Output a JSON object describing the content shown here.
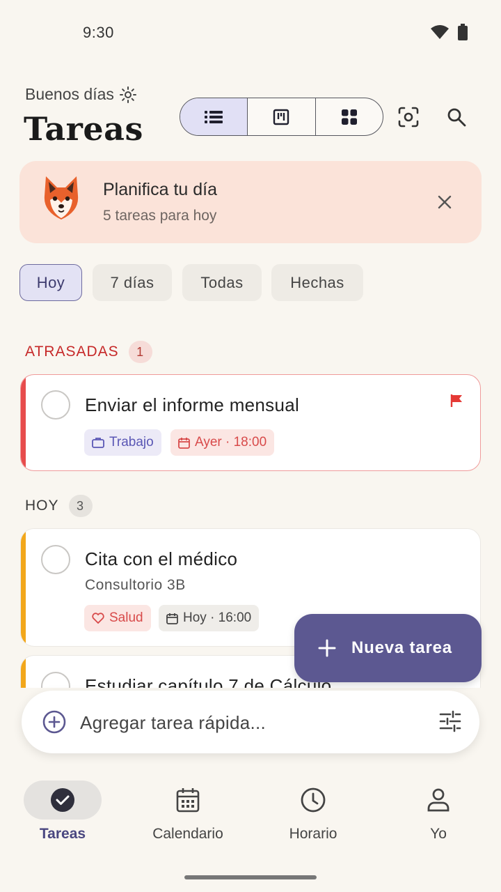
{
  "status_bar": {
    "time": "9:30"
  },
  "header": {
    "greeting": "Buenos días",
    "title": "Tareas"
  },
  "banner": {
    "title": "Planifica tu día",
    "subtitle": "5 tareas para hoy"
  },
  "filters": [
    "Hoy",
    "7 días",
    "Todas",
    "Hechas"
  ],
  "sections": {
    "overdue": {
      "label": "ATRASADAS",
      "count": "1"
    },
    "today": {
      "label": "HOY",
      "count": "3"
    }
  },
  "tasks": [
    {
      "title": "Enviar el informe mensual",
      "category": "Trabajo",
      "due": "Ayer · 18:00",
      "flagged": true
    },
    {
      "title": "Cita con el médico",
      "note": "Consultorio 3B",
      "category": "Salud",
      "due": "Hoy · 16:00"
    },
    {
      "title": "Estudiar capítulo 7 de Cálculo"
    }
  ],
  "fab": {
    "label": "Nueva tarea"
  },
  "quick_add": {
    "placeholder": "Agregar tarea rápida..."
  },
  "bottom_nav": [
    "Tareas",
    "Calendario",
    "Horario",
    "Yo"
  ],
  "colors": {
    "accent": "#5c5891",
    "overdue": "#c62828",
    "work_tag": "#5a57b5",
    "health_tag": "#d84a4a",
    "today_stripe": "#f2a71b"
  }
}
